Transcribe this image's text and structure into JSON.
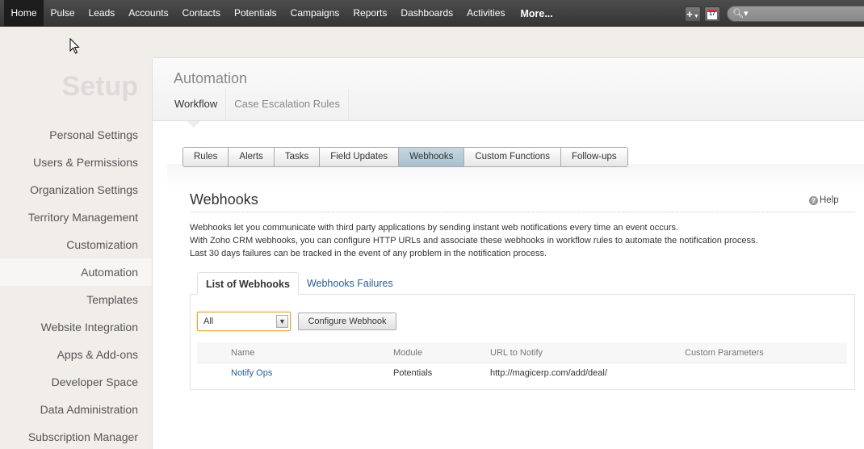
{
  "topnav": {
    "tabs": [
      "Home",
      "Pulse",
      "Leads",
      "Accounts",
      "Contacts",
      "Potentials",
      "Campaigns",
      "Reports",
      "Dashboards",
      "Activities"
    ],
    "more_label": "More...",
    "active_tab": "Home",
    "add_icon": "+",
    "calendar_day": "17",
    "search_placeholder": ""
  },
  "sidebar": {
    "title": "Setup",
    "items": [
      {
        "label": "Personal Settings"
      },
      {
        "label": "Users & Permissions"
      },
      {
        "label": "Organization Settings"
      },
      {
        "label": "Territory Management"
      },
      {
        "label": "Customization"
      },
      {
        "label": "Automation"
      },
      {
        "label": "Templates"
      },
      {
        "label": "Website Integration"
      },
      {
        "label": "Apps & Add-ons"
      },
      {
        "label": "Developer Space"
      },
      {
        "label": "Data Administration"
      },
      {
        "label": "Subscription Manager"
      }
    ],
    "active": "Automation"
  },
  "main": {
    "title": "Automation",
    "subtabs": [
      {
        "label": "Workflow"
      },
      {
        "label": "Case Escalation Rules"
      }
    ],
    "active_subtab": "Workflow",
    "buttons": [
      {
        "label": "Rules"
      },
      {
        "label": "Alerts"
      },
      {
        "label": "Tasks"
      },
      {
        "label": "Field Updates"
      },
      {
        "label": "Webhooks"
      },
      {
        "label": "Custom Functions"
      },
      {
        "label": "Follow-ups"
      }
    ],
    "active_button": "Webhooks",
    "section_title": "Webhooks",
    "help_label": "Help",
    "description": [
      "Webhooks let you communicate with third party applications by sending instant web notifications every time an event occurs.",
      "With Zoho CRM webhooks, you can configure HTTP URLs and associate these webhooks in workflow rules to automate the notification process.",
      "Last 30 days failures can be tracked in the event of any problem in the notification process."
    ],
    "inner_tabs": [
      {
        "label": "List of Webhooks"
      },
      {
        "label": "Webhooks Failures"
      }
    ],
    "active_inner_tab": "List of Webhooks",
    "filter_value": "All",
    "configure_label": "Configure Webhook",
    "table": {
      "columns": [
        "Name",
        "Module",
        "URL to Notify",
        "Custom Parameters"
      ],
      "rows": [
        {
          "name": "Notify Ops",
          "module": "Potentials",
          "url": "http://magicerp.com/add/deal/",
          "params": ""
        }
      ]
    }
  }
}
